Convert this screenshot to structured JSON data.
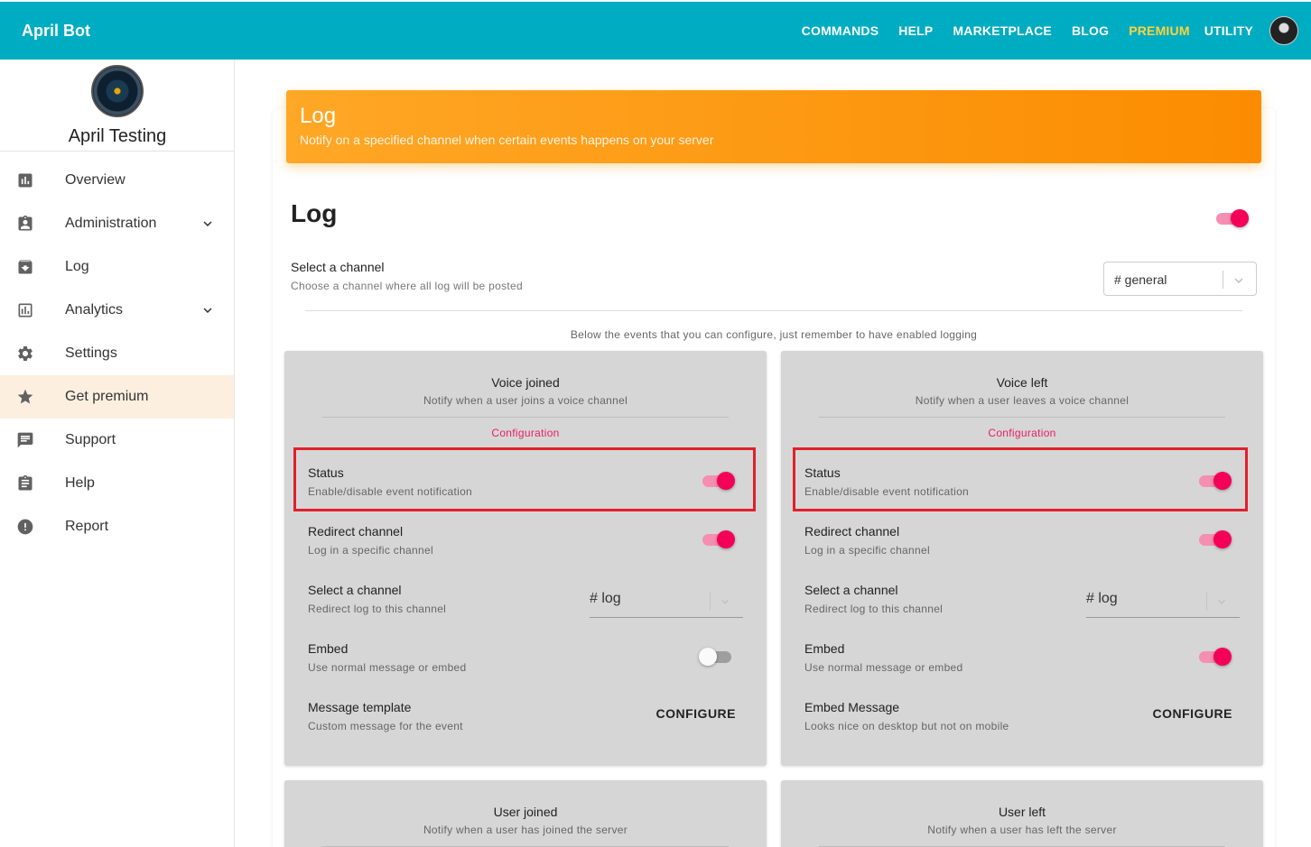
{
  "topbar": {
    "brand": "April Bot",
    "nav": [
      "COMMANDS",
      "HELP",
      "MARKETPLACE",
      "BLOG",
      "PREMIUM",
      "UTILITY"
    ]
  },
  "sidebar": {
    "server_name": "April Testing",
    "items": [
      {
        "label": "Overview",
        "icon": "bar-chart-icon"
      },
      {
        "label": "Administration",
        "icon": "badge-icon",
        "expandable": true
      },
      {
        "label": "Log",
        "icon": "archive-icon"
      },
      {
        "label": "Analytics",
        "icon": "analytics-icon",
        "expandable": true
      },
      {
        "label": "Settings",
        "icon": "gear-icon"
      },
      {
        "label": "Get premium",
        "icon": "star-icon",
        "active": true
      },
      {
        "label": "Support",
        "icon": "chat-icon"
      },
      {
        "label": "Help",
        "icon": "clipboard-icon"
      },
      {
        "label": "Report",
        "icon": "alert-icon"
      }
    ]
  },
  "banner": {
    "title": "Log",
    "subtitle": "Notify on a specified channel when certain events happens on your server"
  },
  "main": {
    "title": "Log",
    "enabled": true,
    "channel_label": "Select a channel",
    "channel_sub": "Choose a channel where all log will be posted",
    "channel_value": "# general",
    "hint": "Below the events that you can configure, just remember to have enabled logging"
  },
  "events": [
    {
      "title": "Voice joined",
      "subtitle": "Notify when a user joins a voice channel",
      "config": "Configuration",
      "status_label": "Status",
      "status_sub": "Enable/disable event notification",
      "status_on": true,
      "redirect_label": "Redirect channel",
      "redirect_sub": "Log in a specific channel",
      "redirect_on": true,
      "select_label": "Select a channel",
      "select_sub": "Redirect log to this channel",
      "select_value": "# log",
      "embed_label": "Embed",
      "embed_sub": "Use normal message or embed",
      "embed_on": false,
      "message_label": "Message template",
      "message_sub": "Custom message for the event",
      "configure": "CONFIGURE"
    },
    {
      "title": "Voice left",
      "subtitle": "Notify when a user leaves a voice channel",
      "config": "Configuration",
      "status_label": "Status",
      "status_sub": "Enable/disable event notification",
      "status_on": true,
      "redirect_label": "Redirect channel",
      "redirect_sub": "Log in a specific channel",
      "redirect_on": true,
      "select_label": "Select a channel",
      "select_sub": "Redirect log to this channel",
      "select_value": "# log",
      "embed_label": "Embed",
      "embed_sub": "Use normal message or embed",
      "embed_on": true,
      "message_label": "Embed Message",
      "message_sub": "Looks nice on desktop but not on mobile",
      "configure": "CONFIGURE"
    },
    {
      "title": "User joined",
      "subtitle": "Notify when a user has joined the server"
    },
    {
      "title": "User left",
      "subtitle": "Notify when a user has left the server"
    }
  ],
  "colors": {
    "topbar": "#00acc1",
    "premium": "#ffd43b",
    "banner": "#fb8c00",
    "accent": "#f50057",
    "highlight": "#e0202c"
  }
}
